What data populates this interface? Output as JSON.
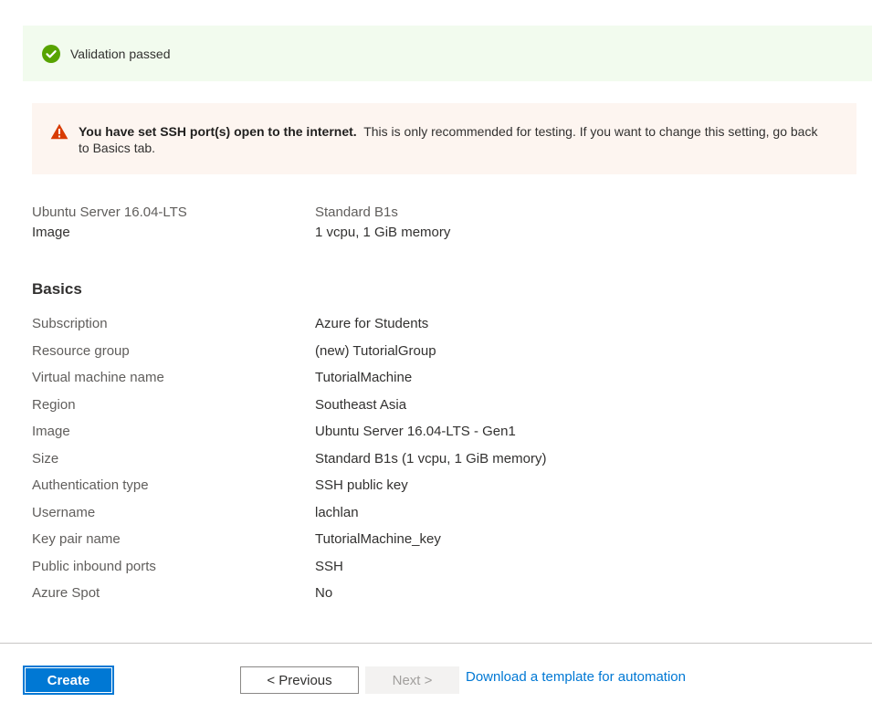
{
  "validation": {
    "message": "Validation passed",
    "icon": "check-circle-icon",
    "color": "#57a300"
  },
  "warning": {
    "icon": "warning-triangle-icon",
    "color": "#d83b01",
    "bold_text": "You have set SSH port(s) open to the internet.",
    "text": "This is only recommended for testing.  If you want to change this setting, go back to Basics tab."
  },
  "summary": {
    "image_name": "Ubuntu Server 16.04-LTS",
    "image_label": "Image",
    "size_name": "Standard B1s",
    "size_detail": "1 vcpu, 1 GiB memory"
  },
  "basics": {
    "heading": "Basics",
    "rows": [
      {
        "label": "Subscription",
        "value": "Azure for Students"
      },
      {
        "label": "Resource group",
        "value": "(new) TutorialGroup"
      },
      {
        "label": "Virtual machine name",
        "value": "TutorialMachine"
      },
      {
        "label": "Region",
        "value": "Southeast Asia"
      },
      {
        "label": "Image",
        "value": "Ubuntu Server 16.04-LTS - Gen1"
      },
      {
        "label": "Size",
        "value": "Standard B1s (1 vcpu, 1 GiB memory)"
      },
      {
        "label": "Authentication type",
        "value": "SSH public key"
      },
      {
        "label": "Username",
        "value": "lachlan"
      },
      {
        "label": "Key pair name",
        "value": "TutorialMachine_key"
      },
      {
        "label": "Public inbound ports",
        "value": "SSH"
      },
      {
        "label": "Azure Spot",
        "value": "No"
      }
    ]
  },
  "footer": {
    "create_label": "Create",
    "previous_label": "< Previous",
    "next_label": "Next >",
    "download_link": "Download a template for automation"
  },
  "colors": {
    "accent": "#0078d4",
    "success_bg": "#f2fbee",
    "warning_bg": "#fdf5f0"
  }
}
